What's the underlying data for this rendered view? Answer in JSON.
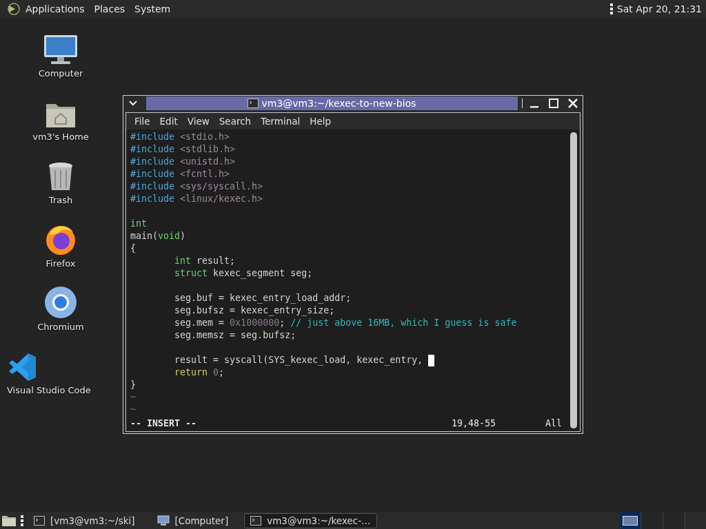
{
  "top_panel": {
    "menus": [
      "Applications",
      "Places",
      "System"
    ],
    "clock": "Sat Apr 20, 21:31"
  },
  "desktop_icons": [
    {
      "label": "Computer",
      "kind": "computer"
    },
    {
      "label": "vm3's Home",
      "kind": "home"
    },
    {
      "label": "Trash",
      "kind": "trash"
    },
    {
      "label": "Firefox",
      "kind": "firefox"
    },
    {
      "label": "Chromium",
      "kind": "chromium"
    },
    {
      "label": "Visual Studio Code",
      "kind": "vscode"
    }
  ],
  "terminal": {
    "title": "vm3@vm3:~/kexec-to-new-bios",
    "menu": [
      "File",
      "Edit",
      "View",
      "Search",
      "Terminal",
      "Help"
    ],
    "lines": [
      {
        "segments": [
          {
            "text": "#include",
            "kind": "preproc"
          },
          {
            "text": " <stdio.h>",
            "kind": "header"
          }
        ]
      },
      {
        "segments": [
          {
            "text": "#include",
            "kind": "preproc"
          },
          {
            "text": " <stdlib.h>",
            "kind": "header"
          }
        ]
      },
      {
        "segments": [
          {
            "text": "#include",
            "kind": "preproc"
          },
          {
            "text": " <unistd.h>",
            "kind": "header"
          }
        ]
      },
      {
        "segments": [
          {
            "text": "#include",
            "kind": "preproc"
          },
          {
            "text": " <fcntl.h>",
            "kind": "header"
          }
        ]
      },
      {
        "segments": [
          {
            "text": "#include",
            "kind": "preproc"
          },
          {
            "text": " <sys/syscall.h>",
            "kind": "header"
          }
        ]
      },
      {
        "segments": [
          {
            "text": "#include",
            "kind": "preproc"
          },
          {
            "text": " <linux/kexec.h>",
            "kind": "header"
          }
        ]
      },
      {
        "segments": [
          {
            "text": "int",
            "kind": "type"
          }
        ],
        "blank_line_before": true
      },
      {
        "segments": [
          {
            "text": "main(",
            "kind": "plain"
          },
          {
            "text": "void",
            "kind": "type"
          },
          {
            "text": ")",
            "kind": "plain"
          }
        ]
      },
      {
        "segments": [
          {
            "text": "{",
            "kind": "plain"
          }
        ]
      },
      {
        "segments": [
          {
            "text": "        int",
            "kind": "type"
          },
          {
            "text": " result;",
            "kind": "plain"
          }
        ]
      },
      {
        "segments": [
          {
            "text": "        struct",
            "kind": "type"
          },
          {
            "text": " kexec_segment seg;",
            "kind": "plain"
          }
        ]
      },
      {
        "segments": [
          {
            "text": "        seg.buf = kexec_entry_load_addr;",
            "kind": "plain"
          }
        ],
        "blank_line_before": true
      },
      {
        "segments": [
          {
            "text": "        seg.bufsz = kexec_entry_size;",
            "kind": "plain"
          }
        ]
      },
      {
        "segments": [
          {
            "text": "        seg.mem = ",
            "kind": "plain"
          },
          {
            "text": "0x1000000",
            "kind": "number"
          },
          {
            "text": "; ",
            "kind": "plain"
          },
          {
            "text": "// just above 16MB, which I guess is safe",
            "kind": "comment"
          }
        ]
      },
      {
        "segments": [
          {
            "text": "        seg.memsz = seg.bufsz;",
            "kind": "plain"
          }
        ]
      },
      {
        "segments": [
          {
            "text": "        result = syscall(SYS_kexec_load, kexec_entry, ",
            "kind": "plain"
          }
        ],
        "cursor": true,
        "blank_line_before": true
      },
      {
        "segments": [
          {
            "text": "        return ",
            "kind": "statement"
          },
          {
            "text": "0",
            "kind": "number"
          },
          {
            "text": ";",
            "kind": "plain"
          }
        ]
      },
      {
        "segments": [
          {
            "text": "}",
            "kind": "plain"
          }
        ]
      },
      {
        "segments": [
          {
            "text": "~",
            "kind": "filler"
          }
        ]
      },
      {
        "segments": [
          {
            "text": "~",
            "kind": "filler"
          }
        ]
      }
    ],
    "status": {
      "mode": "-- INSERT --",
      "position": "19,48-55",
      "scroll": "All"
    }
  },
  "taskbar": {
    "tasks": [
      {
        "label": "[vm3@vm3:~/ski]",
        "kind": "terminal",
        "selected": false
      },
      {
        "label": "[Computer]",
        "kind": "computer",
        "selected": false
      },
      {
        "label": "vm3@vm3:~/kexec-…",
        "kind": "terminal",
        "selected": true
      }
    ],
    "workspaces": [
      {
        "selected": true
      },
      {
        "selected": false
      },
      {
        "selected": false
      }
    ]
  }
}
